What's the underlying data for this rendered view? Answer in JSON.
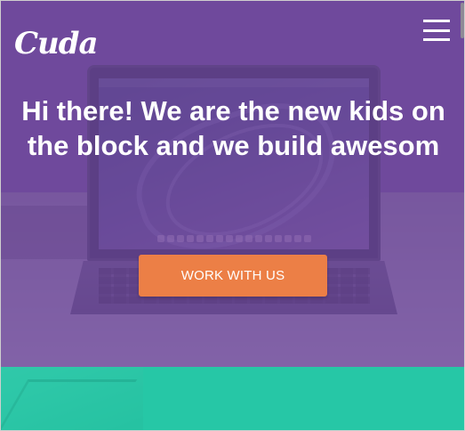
{
  "brand": {
    "logo_text": "Cuda"
  },
  "header": {
    "menu_icon": "hamburger-menu-icon"
  },
  "hero": {
    "headline": "Hi there! We are the new kids on the block and we build awesom",
    "cta_label": "WORK WITH US",
    "overlay_color": "#7049a0"
  },
  "colors": {
    "cta": "#ec7f46",
    "teal_section": "#27c7a6",
    "text": "#ffffff"
  }
}
